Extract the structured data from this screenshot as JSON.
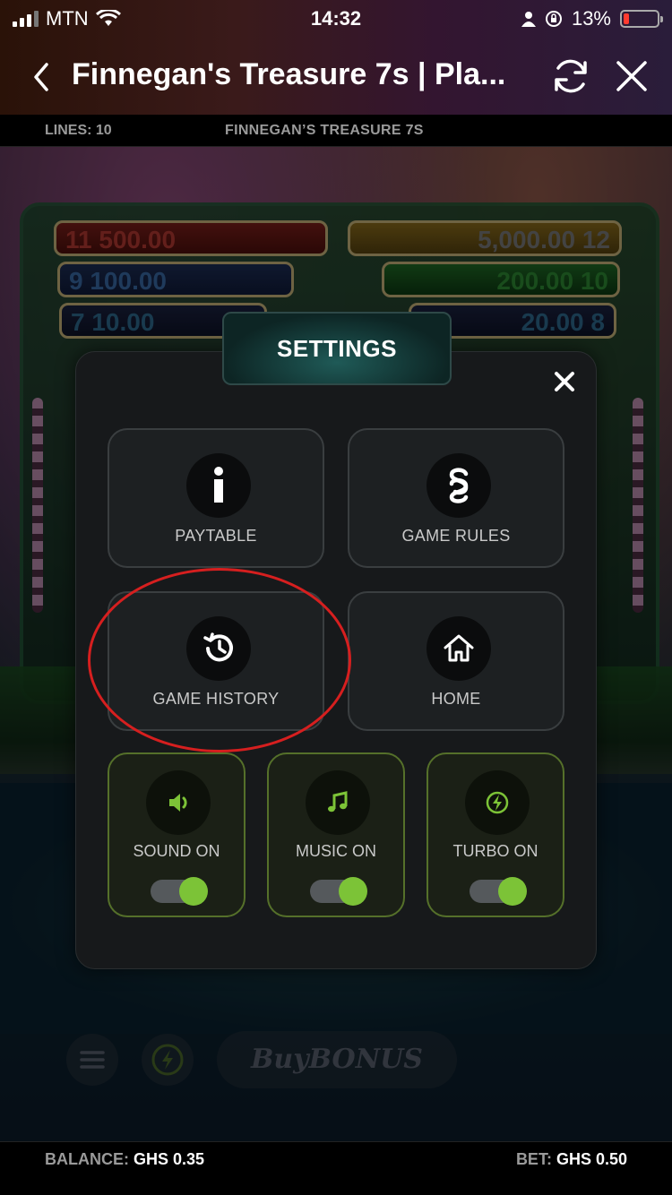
{
  "status_bar": {
    "carrier": "MTN",
    "time": "14:32",
    "battery": "13%"
  },
  "header": {
    "title": "Finnegan's Treasure 7s | Pla..."
  },
  "info_bar": {
    "lines": "LINES: 10",
    "game_name": "FINNEGAN’S TREASURE 7S"
  },
  "game_background": {
    "prizes": [
      {
        "num": "11",
        "value": "500.00"
      },
      {
        "num": "12",
        "value": "5,000.00"
      },
      {
        "num": "9",
        "value": "100.00"
      },
      {
        "num": "10",
        "value": "200.00"
      },
      {
        "num": "7",
        "value": "10.00"
      },
      {
        "num": "8",
        "value": "20.00"
      }
    ],
    "buy_bonus": "BuyBONUS"
  },
  "settings": {
    "title": "SETTINGS",
    "tiles": [
      {
        "label": "PAYTABLE",
        "icon": "info-icon"
      },
      {
        "label": "GAME RULES",
        "icon": "section-icon"
      },
      {
        "label": "GAME HISTORY",
        "icon": "history-icon"
      },
      {
        "label": "HOME",
        "icon": "home-icon"
      }
    ],
    "toggles": [
      {
        "label": "SOUND ON",
        "icon": "speaker-icon",
        "on": true
      },
      {
        "label": "MUSIC ON",
        "icon": "music-note-icon",
        "on": true
      },
      {
        "label": "TURBO ON",
        "icon": "lightning-icon",
        "on": true
      }
    ]
  },
  "footer": {
    "balance_label": "BALANCE:",
    "balance_value": "GHS 0.35",
    "bet_label": "BET:",
    "bet_value": "GHS 0.50"
  },
  "colors": {
    "accent_green": "#7cc337",
    "annotation_red": "#d61f1f"
  }
}
